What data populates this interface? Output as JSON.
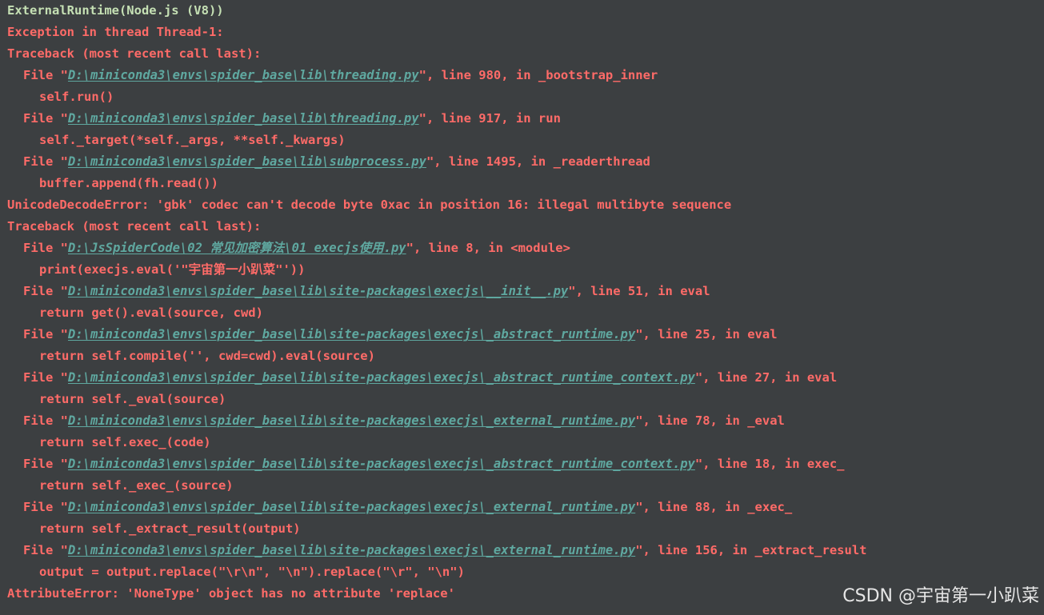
{
  "colors": {
    "background": "#3c3f41",
    "error_text": "#ff6b68",
    "plain_text": "#c5e0b4",
    "file_link": "#5fa8a0",
    "watermark": "#e6e6e6"
  },
  "console": {
    "lines": [
      {
        "kind": "plain",
        "text": "ExternalRuntime(Node.js (V8))"
      },
      {
        "kind": "error",
        "text": "Exception in thread Thread-1:"
      },
      {
        "kind": "error",
        "text": "Traceback (most recent call last):"
      },
      {
        "kind": "file",
        "prefix": "File \"",
        "path": "D:\\miniconda3\\envs\\spider_base\\lib\\threading.py",
        "suffix": "\", line 980, in _bootstrap_inner"
      },
      {
        "kind": "code",
        "text": "self.run()"
      },
      {
        "kind": "file",
        "prefix": "File \"",
        "path": "D:\\miniconda3\\envs\\spider_base\\lib\\threading.py",
        "suffix": "\", line 917, in run"
      },
      {
        "kind": "code",
        "text": "self._target(*self._args, **self._kwargs)"
      },
      {
        "kind": "file",
        "prefix": "File \"",
        "path": "D:\\miniconda3\\envs\\spider_base\\lib\\subprocess.py",
        "suffix": "\", line 1495, in _readerthread"
      },
      {
        "kind": "code",
        "text": "buffer.append(fh.read())"
      },
      {
        "kind": "error",
        "text": "UnicodeDecodeError: 'gbk' codec can't decode byte 0xac in position 16: illegal multibyte sequence"
      },
      {
        "kind": "error",
        "text": "Traceback (most recent call last):"
      },
      {
        "kind": "file",
        "prefix": "File \"",
        "path": "D:\\JsSpiderCode\\02 常见加密算法\\01 execjs使用.py",
        "suffix": "\", line 8, in <module>"
      },
      {
        "kind": "code",
        "text": "print(execjs.eval('\"宇宙第一小趴菜\"'))"
      },
      {
        "kind": "file",
        "prefix": "File \"",
        "path": "D:\\miniconda3\\envs\\spider_base\\lib\\site-packages\\execjs\\__init__.py",
        "suffix": "\", line 51, in eval"
      },
      {
        "kind": "code",
        "text": "return get().eval(source, cwd)"
      },
      {
        "kind": "file",
        "prefix": "File \"",
        "path": "D:\\miniconda3\\envs\\spider_base\\lib\\site-packages\\execjs\\_abstract_runtime.py",
        "suffix": "\", line 25, in eval"
      },
      {
        "kind": "code",
        "text": "return self.compile('', cwd=cwd).eval(source)"
      },
      {
        "kind": "file",
        "prefix": "File \"",
        "path": "D:\\miniconda3\\envs\\spider_base\\lib\\site-packages\\execjs\\_abstract_runtime_context.py",
        "suffix": "\", line 27, in eval"
      },
      {
        "kind": "code",
        "text": "return self._eval(source)"
      },
      {
        "kind": "file",
        "prefix": "File \"",
        "path": "D:\\miniconda3\\envs\\spider_base\\lib\\site-packages\\execjs\\_external_runtime.py",
        "suffix": "\", line 78, in _eval"
      },
      {
        "kind": "code",
        "text": "return self.exec_(code)"
      },
      {
        "kind": "file",
        "prefix": "File \"",
        "path": "D:\\miniconda3\\envs\\spider_base\\lib\\site-packages\\execjs\\_abstract_runtime_context.py",
        "suffix": "\", line 18, in exec_"
      },
      {
        "kind": "code",
        "text": "return self._exec_(source)"
      },
      {
        "kind": "file",
        "prefix": "File \"",
        "path": "D:\\miniconda3\\envs\\spider_base\\lib\\site-packages\\execjs\\_external_runtime.py",
        "suffix": "\", line 88, in _exec_"
      },
      {
        "kind": "code",
        "text": "return self._extract_result(output)"
      },
      {
        "kind": "file",
        "prefix": "File \"",
        "path": "D:\\miniconda3\\envs\\spider_base\\lib\\site-packages\\execjs\\_external_runtime.py",
        "suffix": "\", line 156, in _extract_result"
      },
      {
        "kind": "code",
        "text": "output = output.replace(\"\\r\\n\", \"\\n\").replace(\"\\r\", \"\\n\")"
      },
      {
        "kind": "error",
        "text": "AttributeError: 'NoneType' object has no attribute 'replace'"
      }
    ]
  },
  "watermark": {
    "text": "CSDN @宇宙第一小趴菜"
  }
}
